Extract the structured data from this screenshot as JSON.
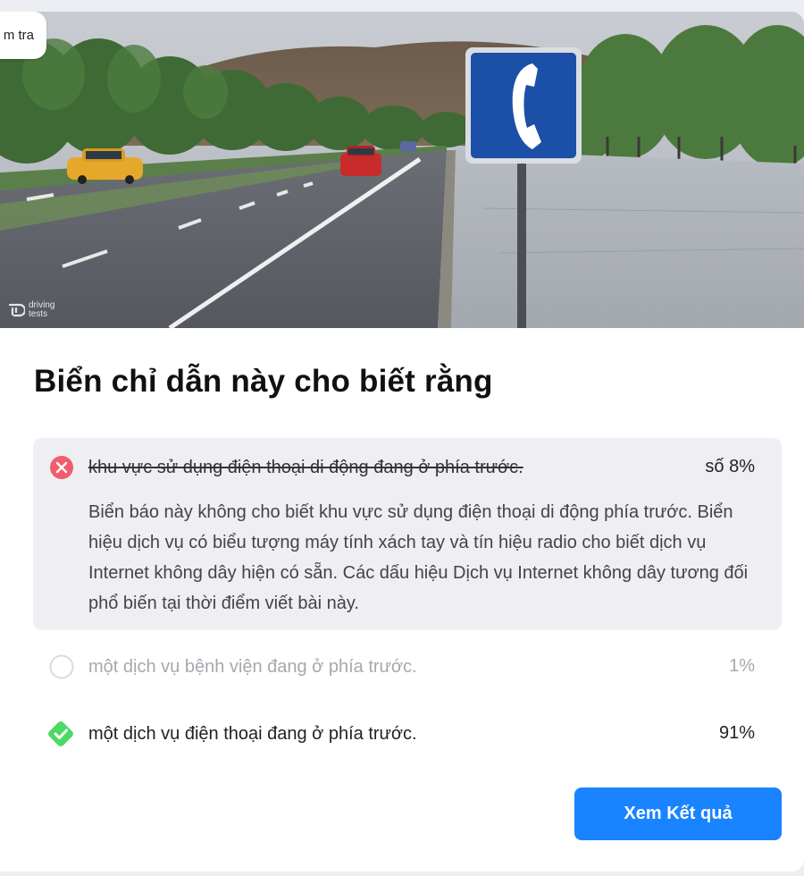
{
  "header": {
    "back_label": "m tra"
  },
  "hero": {
    "watermark_line1": "driving",
    "watermark_line2": "tests"
  },
  "question": {
    "title": "Biển chỉ dẫn này cho biết rằng"
  },
  "answers": [
    {
      "text": "khu vực sử dụng điện thoại di động đang ở phía trước.",
      "percent": "số 8%",
      "state": "wrong",
      "explanation": "Biển báo này không cho biết khu vực sử dụng điện thoại di động phía trước. Biển hiệu dịch vụ có biểu tượng máy tính xách tay và tín hiệu radio cho biết dịch vụ Internet không dây hiện có sẵn. Các dấu hiệu Dịch vụ Internet không dây tương đối phổ biến tại thời điểm viết bài này."
    },
    {
      "text": "một dịch vụ bệnh viện đang ở phía trước.",
      "percent": "1%",
      "state": "unselected"
    },
    {
      "text": "một dịch vụ điện thoại đang ở phía trước.",
      "percent": "91%",
      "state": "correct"
    }
  ],
  "actions": {
    "results_label": "Xem Kết quả"
  },
  "colors": {
    "wrong": "#f25c6c",
    "correct": "#4cd964",
    "primary": "#1a83ff"
  }
}
